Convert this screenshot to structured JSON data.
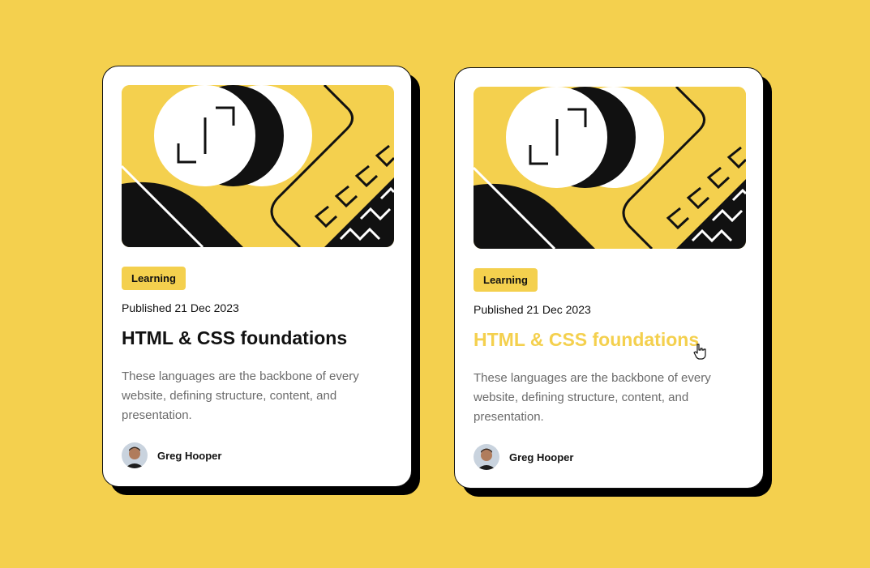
{
  "colors": {
    "background": "#f4d04e",
    "card": "#ffffff",
    "ink": "#111111",
    "muted_text": "#6b6b6b",
    "accent": "#f4d04e"
  },
  "cards": [
    {
      "image": "abstract-yellow-illustration",
      "tag": "Learning",
      "published": "Published 21 Dec 2023",
      "title": "HTML & CSS foundations",
      "title_state": "normal",
      "description": "These languages are the backbone of every website, defining structure, content, and presentation.",
      "author": {
        "avatar": "greg-hooper-avatar",
        "name": "Greg Hooper"
      }
    },
    {
      "image": "abstract-yellow-illustration",
      "tag": "Learning",
      "published": "Published 21 Dec 2023",
      "title": "HTML & CSS foundations",
      "title_state": "hover",
      "description": "These languages are the backbone of every website, defining structure, content, and presentation.",
      "author": {
        "avatar": "greg-hooper-avatar",
        "name": "Greg Hooper"
      }
    }
  ],
  "pointer": "hand-pointer-cursor"
}
